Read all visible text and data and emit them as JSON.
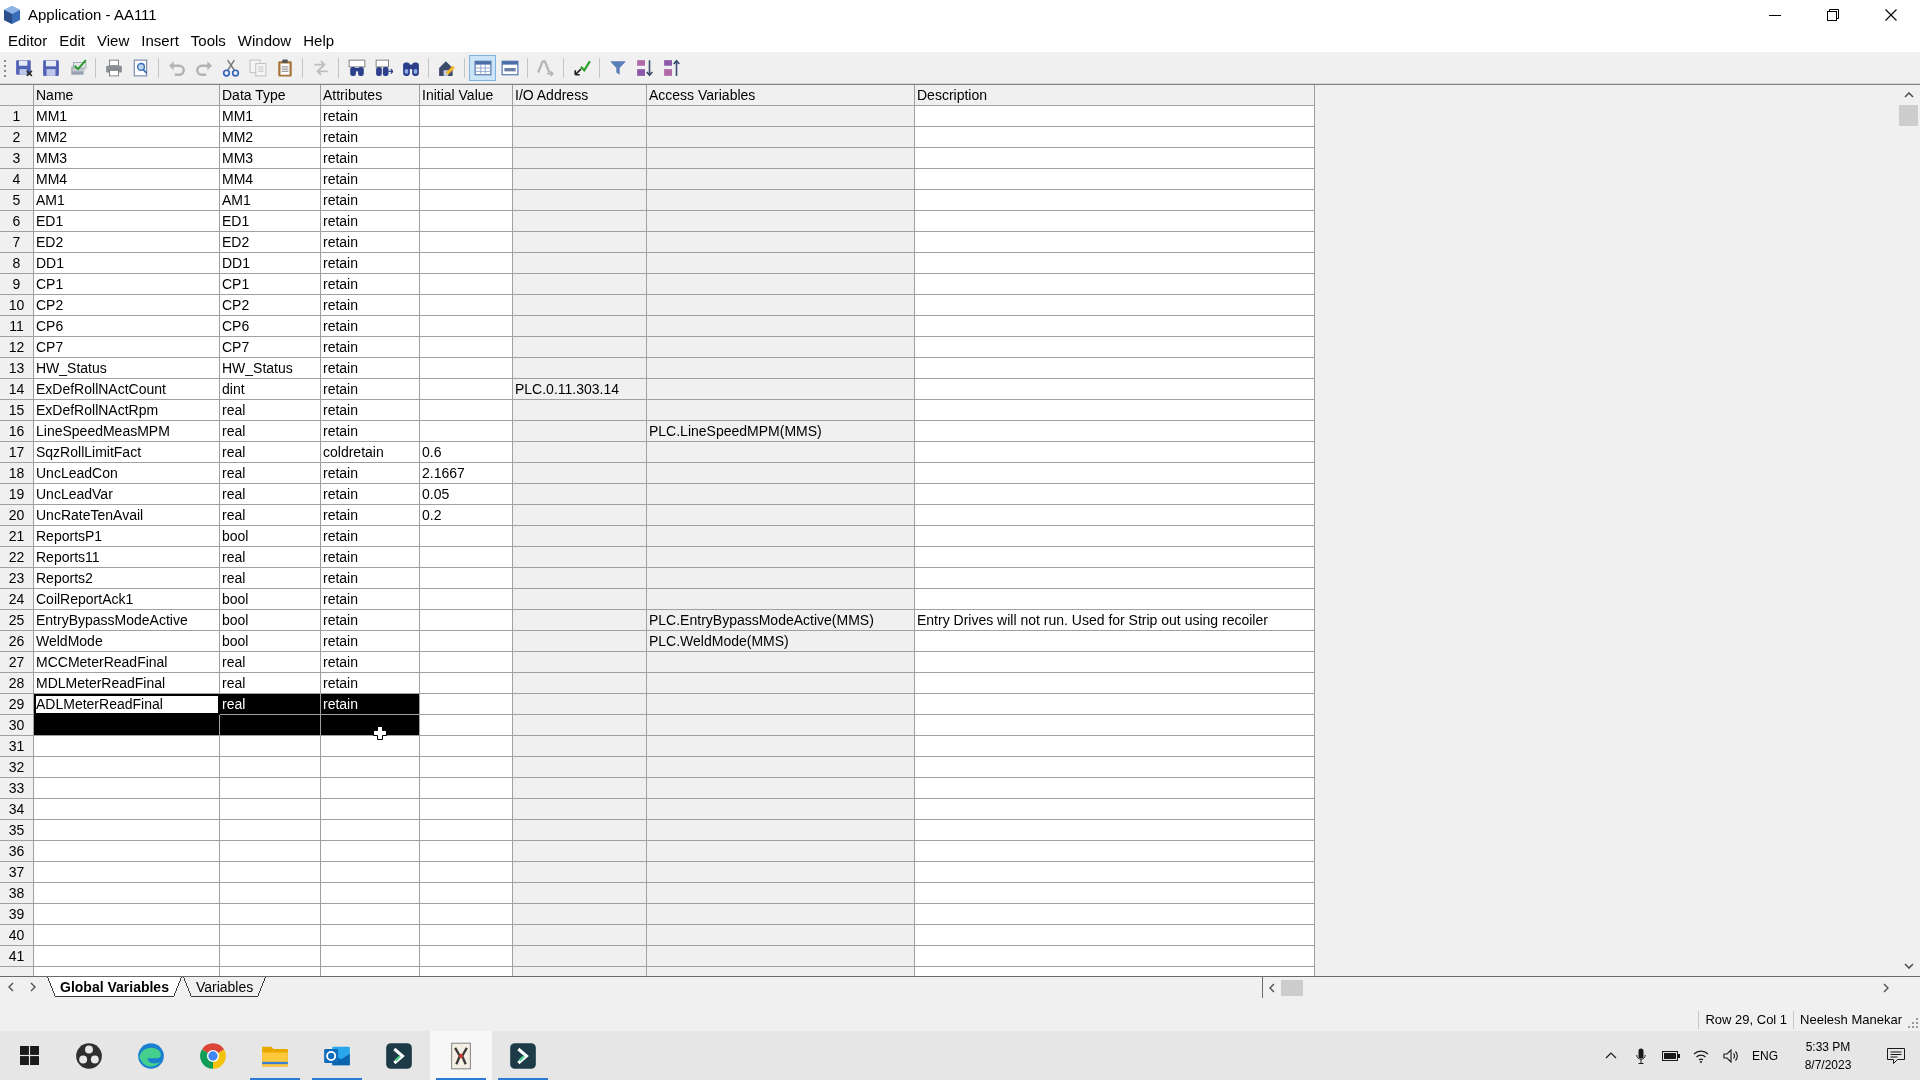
{
  "window": {
    "title": "Application - AA111"
  },
  "menu": [
    "Editor",
    "Edit",
    "View",
    "Insert",
    "Tools",
    "Window",
    "Help"
  ],
  "toolbar": {
    "groups": [
      {
        "items": [
          {
            "disabled": false,
            "pressed": false
          },
          {
            "disabled": false,
            "pressed": false
          },
          {
            "disabled": false,
            "pressed": false
          }
        ]
      },
      {
        "items": [
          {
            "disabled": false,
            "pressed": false
          },
          {
            "disabled": false,
            "pressed": false
          }
        ]
      },
      {
        "items": [
          {
            "disabled": true,
            "pressed": false
          },
          {
            "disabled": true,
            "pressed": false
          },
          {
            "disabled": false,
            "pressed": false
          },
          {
            "disabled": true,
            "pressed": false
          },
          {
            "disabled": false,
            "pressed": false
          }
        ]
      },
      {
        "items": [
          {
            "disabled": true,
            "pressed": false
          }
        ]
      },
      {
        "items": [
          {
            "disabled": false,
            "pressed": false
          },
          {
            "disabled": false,
            "pressed": false
          },
          {
            "disabled": false,
            "pressed": false
          }
        ]
      },
      {
        "items": [
          {
            "disabled": false,
            "pressed": false
          }
        ]
      },
      {
        "items": [
          {
            "disabled": false,
            "pressed": true
          },
          {
            "disabled": false,
            "pressed": false
          }
        ]
      },
      {
        "items": [
          {
            "disabled": true,
            "pressed": false
          }
        ]
      },
      {
        "items": [
          {
            "disabled": false,
            "pressed": false
          }
        ]
      },
      {
        "items": [
          {
            "disabled": false,
            "pressed": false
          },
          {
            "disabled": false,
            "pressed": false
          },
          {
            "disabled": false,
            "pressed": false
          }
        ]
      }
    ]
  },
  "table": {
    "columns": [
      {
        "label": "Name",
        "selected": true,
        "read_only": false
      },
      {
        "label": "Data Type",
        "selected": true,
        "read_only": false
      },
      {
        "label": "Attributes",
        "selected": true,
        "read_only": false
      },
      {
        "label": "Initial Value",
        "selected": false,
        "read_only": false
      },
      {
        "label": "I/O Address",
        "selected": false,
        "read_only": true
      },
      {
        "label": "Access Variables",
        "selected": false,
        "read_only": true
      },
      {
        "label": "Description",
        "selected": false,
        "read_only": false
      }
    ],
    "rows": [
      {
        "number": "1",
        "name": "MM1",
        "data_type": "MM1",
        "attributes": "retain",
        "selected": false,
        "active": false
      },
      {
        "number": "2",
        "name": "MM2",
        "data_type": "MM2",
        "attributes": "retain",
        "selected": false,
        "active": false
      },
      {
        "number": "3",
        "name": "MM3",
        "data_type": "MM3",
        "attributes": "retain",
        "selected": false,
        "active": false
      },
      {
        "number": "4",
        "name": "MM4",
        "data_type": "MM4",
        "attributes": "retain",
        "selected": false,
        "active": false
      },
      {
        "number": "5",
        "name": "AM1",
        "data_type": "AM1",
        "attributes": "retain",
        "selected": false,
        "active": false
      },
      {
        "number": "6",
        "name": "ED1",
        "data_type": "ED1",
        "attributes": "retain",
        "selected": false,
        "active": false
      },
      {
        "number": "7",
        "name": "ED2",
        "data_type": "ED2",
        "attributes": "retain",
        "selected": false,
        "active": false
      },
      {
        "number": "8",
        "name": "DD1",
        "data_type": "DD1",
        "attributes": "retain",
        "selected": false,
        "active": false
      },
      {
        "number": "9",
        "name": "CP1",
        "data_type": "CP1",
        "attributes": "retain",
        "selected": false,
        "active": false
      },
      {
        "number": "10",
        "name": "CP2",
        "data_type": "CP2",
        "attributes": "retain",
        "selected": false,
        "active": false
      },
      {
        "number": "11",
        "name": "CP6",
        "data_type": "CP6",
        "attributes": "retain",
        "selected": false,
        "active": false
      },
      {
        "number": "12",
        "name": "CP7",
        "data_type": "CP7",
        "attributes": "retain",
        "selected": false,
        "active": false
      },
      {
        "number": "13",
        "name": "HW_Status",
        "data_type": "HW_Status",
        "attributes": "retain",
        "selected": false,
        "active": false
      },
      {
        "number": "14",
        "name": "ExDefRollNActCount",
        "data_type": "dint",
        "attributes": "retain",
        "io_address": "PLC.0.11.303.14",
        "selected": false,
        "active": false
      },
      {
        "number": "15",
        "name": "ExDefRollNActRpm",
        "data_type": "real",
        "attributes": "retain",
        "selected": false,
        "active": false
      },
      {
        "number": "16",
        "name": "LineSpeedMeasMPM",
        "data_type": "real",
        "attributes": "retain",
        "access_variables": "PLC.LineSpeedMPM(MMS)",
        "selected": false,
        "active": false
      },
      {
        "number": "17",
        "name": "SqzRollLimitFact",
        "data_type": "real",
        "attributes": "coldretain",
        "initial_value": "0.6",
        "selected": false,
        "active": false
      },
      {
        "number": "18",
        "name": "UncLeadCon",
        "data_type": "real",
        "attributes": "retain",
        "initial_value": "2.1667",
        "selected": false,
        "active": false
      },
      {
        "number": "19",
        "name": "UncLeadVar",
        "data_type": "real",
        "attributes": "retain",
        "initial_value": "0.05",
        "selected": false,
        "active": false
      },
      {
        "number": "20",
        "name": "UncRateTenAvail",
        "data_type": "real",
        "attributes": "retain",
        "initial_value": "0.2",
        "selected": false,
        "active": false
      },
      {
        "number": "21",
        "name": "ReportsP1",
        "data_type": "bool",
        "attributes": "retain",
        "selected": false,
        "active": false
      },
      {
        "number": "22",
        "name": "Reports11",
        "data_type": "real",
        "attributes": "retain",
        "selected": false,
        "active": false
      },
      {
        "number": "23",
        "name": "Reports2",
        "data_type": "real",
        "attributes": "retain",
        "selected": false,
        "active": false
      },
      {
        "number": "24",
        "name": "CoilReportAck1",
        "data_type": "bool",
        "attributes": "retain",
        "selected": false,
        "active": false
      },
      {
        "number": "25",
        "name": "EntryBypassModeActive",
        "data_type": "bool",
        "attributes": "retain",
        "access_variables": "PLC.EntryBypassModeActive(MMS)",
        "description": "Entry Drives will not run. Used for Strip out using recoiler",
        "selected": false,
        "active": false
      },
      {
        "number": "26",
        "name": "WeldMode",
        "data_type": "bool",
        "attributes": "retain",
        "access_variables": "PLC.WeldMode(MMS)",
        "selected": false,
        "active": false
      },
      {
        "number": "27",
        "name": "MCCMeterReadFinal",
        "data_type": "real",
        "attributes": "retain",
        "selected": false,
        "active": false
      },
      {
        "number": "28",
        "name": "MDLMeterReadFinal",
        "data_type": "real",
        "attributes": "retain",
        "selected": false,
        "active": false
      },
      {
        "number": "29",
        "name": "ADLMeterReadFinal",
        "data_type": "real",
        "attributes": "retain",
        "selected": true,
        "active": true
      },
      {
        "number": "30",
        "selected": true,
        "active": false
      },
      {
        "number": "31",
        "selected": false,
        "active": false
      },
      {
        "number": "32",
        "selected": false,
        "active": false
      },
      {
        "number": "33",
        "selected": false,
        "active": false
      },
      {
        "number": "34",
        "selected": false,
        "active": false
      },
      {
        "number": "35",
        "selected": false,
        "active": false
      },
      {
        "number": "36",
        "selected": false,
        "active": false
      },
      {
        "number": "37",
        "selected": false,
        "active": false
      },
      {
        "number": "38",
        "selected": false,
        "active": false
      },
      {
        "number": "39",
        "selected": false,
        "active": false
      },
      {
        "number": "40",
        "selected": false,
        "active": false
      },
      {
        "number": "41",
        "selected": false,
        "active": false
      }
    ]
  },
  "sheet_tabs": [
    {
      "label": "Global Variables",
      "selected": true
    },
    {
      "label": "Variables",
      "selected": false
    }
  ],
  "status_bar": {
    "position": "Row 29, Col 1",
    "user": "Neelesh Manekar"
  },
  "taskbar": {
    "apps": [
      {
        "running": false,
        "active": false
      },
      {
        "running": false,
        "active": false
      },
      {
        "running": false,
        "active": false
      },
      {
        "running": true,
        "active": false
      },
      {
        "running": true,
        "active": false
      },
      {
        "running": false,
        "active": false
      },
      {
        "running": true,
        "active": true
      },
      {
        "running": true,
        "active": false
      }
    ],
    "language": "ENG",
    "time": "5:33 PM",
    "date": "8/7/2023"
  }
}
